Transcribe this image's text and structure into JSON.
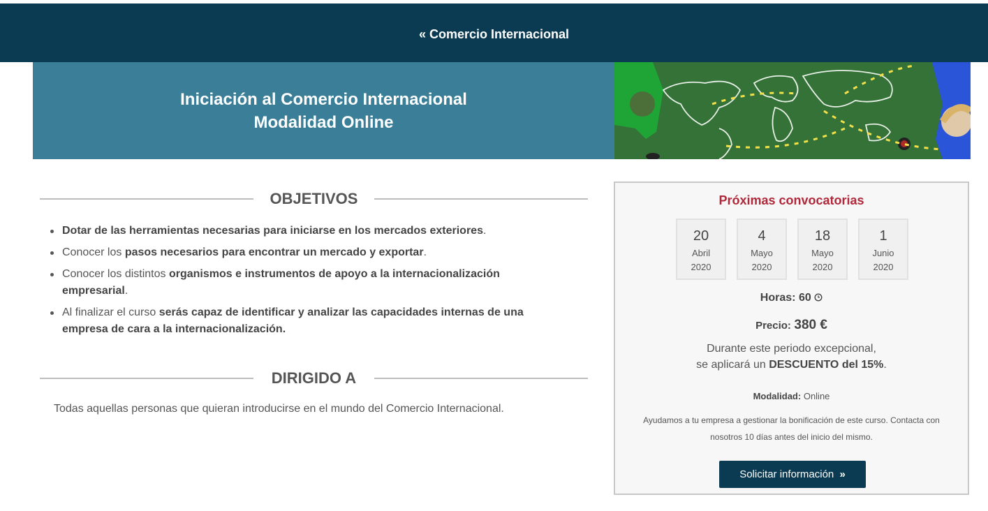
{
  "topbar": {
    "back_link": "« Comercio Internacional"
  },
  "hero": {
    "title_line1": "Iniciación al Comercio Internacional",
    "title_line2": "Modalidad Online"
  },
  "objetivos": {
    "heading": "OBJETIVOS",
    "items": [
      {
        "pre": "",
        "bold": "Dotar de las herramientas necesarias para iniciarse en los mercados exteriores",
        "post": "."
      },
      {
        "pre": "Conocer los ",
        "bold": "pasos necesarios para encontrar un mercado y exportar",
        "post": "."
      },
      {
        "pre": "Conocer los distintos ",
        "bold": "organismos e instrumentos de apoyo a la internacionalización empresarial",
        "post": "."
      },
      {
        "pre": "Al finalizar el curso ",
        "bold": "serás capaz de identificar y analizar las capacidades internas de una empresa de cara a la internacionalización.",
        "post": ""
      }
    ]
  },
  "dirigido": {
    "heading": "DIRIGIDO A",
    "text": "Todas aquellas personas que quieran introducirse en el mundo del Comercio Internacional."
  },
  "panel": {
    "title": "Próximas convocatorias",
    "dates": [
      {
        "day": "20",
        "month": "Abril",
        "year": "2020"
      },
      {
        "day": "4",
        "month": "Mayo",
        "year": "2020"
      },
      {
        "day": "18",
        "month": "Mayo",
        "year": "2020"
      },
      {
        "day": "1",
        "month": "Junio",
        "year": "2020"
      }
    ],
    "horas_label": "Horas:",
    "horas_value": "60",
    "precio_label": "Precio:",
    "precio_value": "380 €",
    "discount_line1": "Durante este periodo excepcional,",
    "discount_pre": "se aplicará un ",
    "discount_bold": "DESCUENTO del 15%",
    "discount_post": ".",
    "modalidad_label": "Modalidad:",
    "modalidad_value": "Online",
    "help_line1": "Ayudamos a tu empresa a gestionar la bonificación de este curso. Contacta con",
    "help_line2": "nosotros 10 días antes del inicio del mismo.",
    "button_label": "Solicitar información",
    "colors": {
      "accent": "#b0283a",
      "navy": "#0b3b52",
      "hero": "#3a7e97"
    }
  }
}
